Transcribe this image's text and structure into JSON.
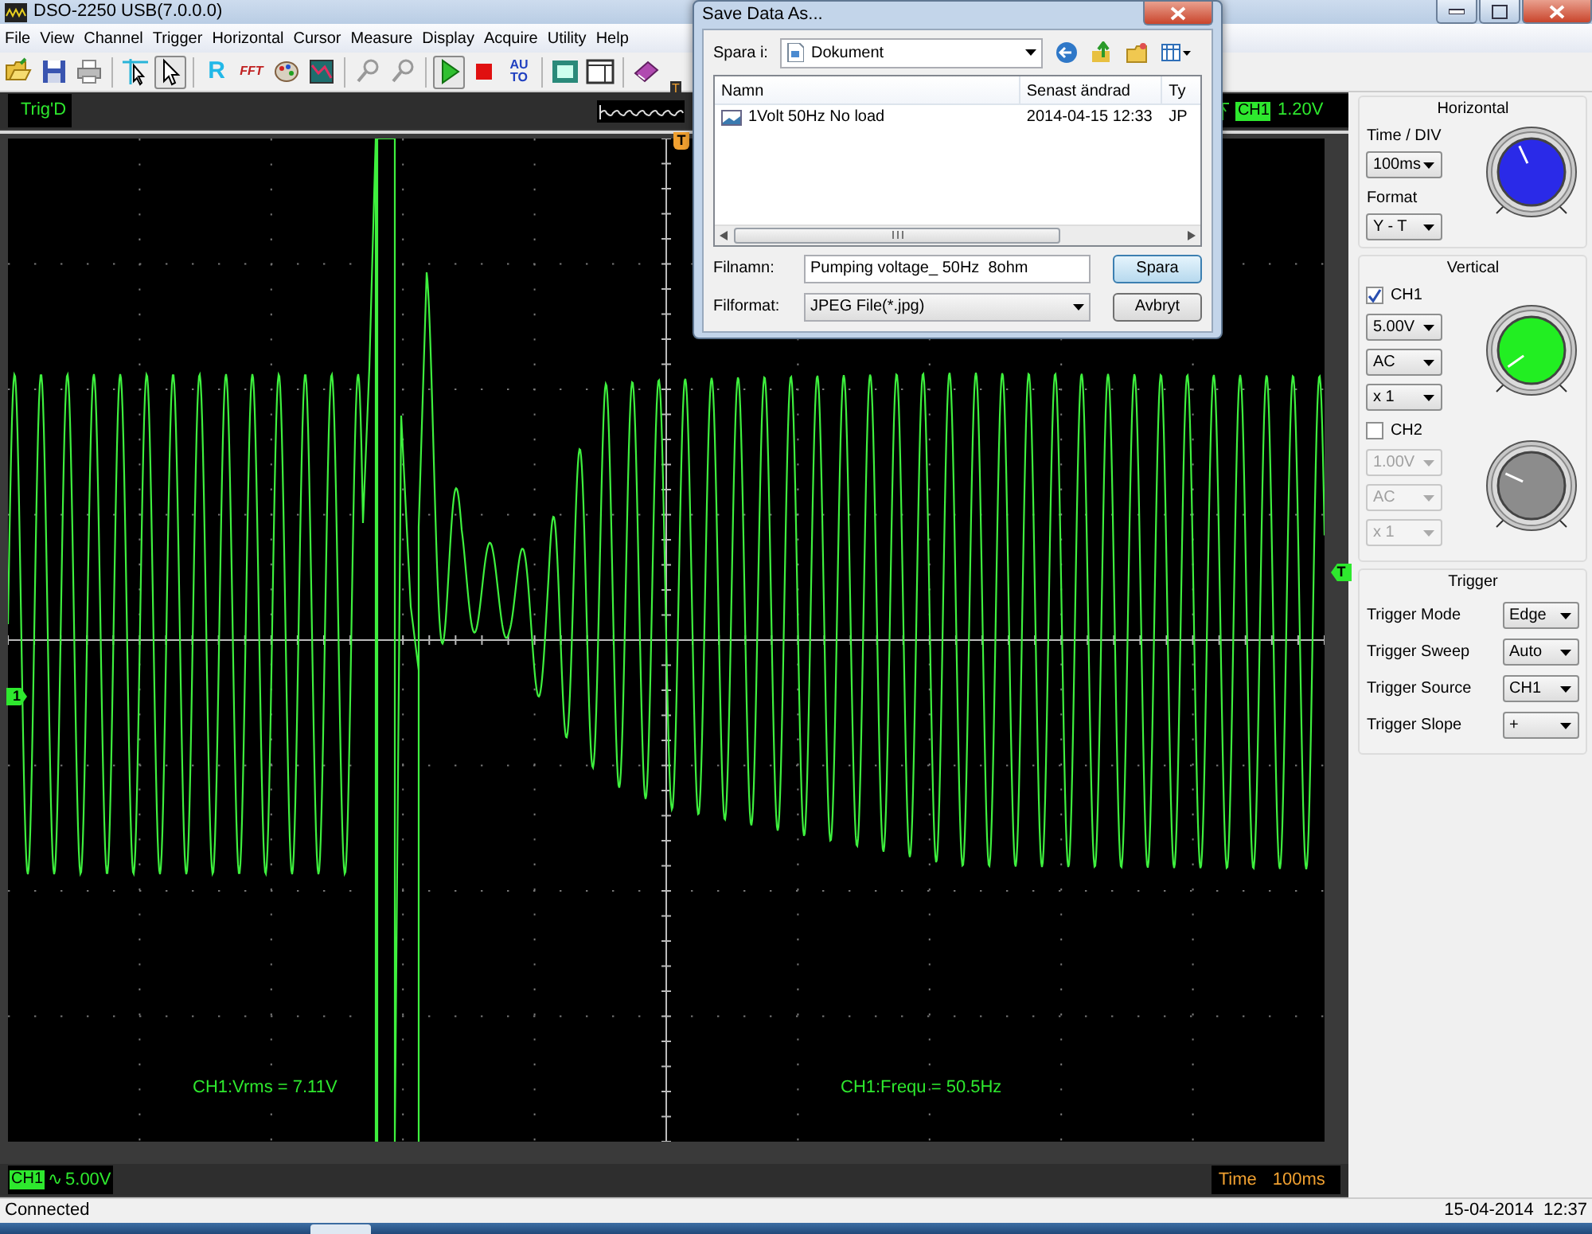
{
  "window": {
    "title": "DSO-2250 USB(7.0.0.0)"
  },
  "menu": [
    "File",
    "View",
    "Channel",
    "Trigger",
    "Horizontal",
    "Cursor",
    "Measure",
    "Display",
    "Acquire",
    "Utility",
    "Help"
  ],
  "toolbar": [
    {
      "kind": "open",
      "pressed": false
    },
    {
      "kind": "save",
      "pressed": false
    },
    {
      "kind": "print",
      "pressed": false
    },
    {
      "kind": "separator"
    },
    {
      "kind": "cursor",
      "pressed": false
    },
    {
      "kind": "pointer",
      "pressed": true
    },
    {
      "kind": "separator"
    },
    {
      "kind": "text",
      "label": "R",
      "pressed": false
    },
    {
      "kind": "fft",
      "label": "FFT",
      "pressed": false
    },
    {
      "kind": "palette",
      "pressed": false
    },
    {
      "kind": "chart",
      "pressed": false
    },
    {
      "kind": "separator"
    },
    {
      "kind": "zoom",
      "pressed": false
    },
    {
      "kind": "zoom",
      "pressed": false
    },
    {
      "kind": "separator"
    },
    {
      "kind": "run",
      "pressed": true
    },
    {
      "kind": "stop",
      "pressed": false
    },
    {
      "kind": "auto",
      "label": "AUTO",
      "pressed": false
    },
    {
      "kind": "separator"
    },
    {
      "kind": "fullscreen",
      "pressed": false
    },
    {
      "kind": "panel",
      "pressed": false
    },
    {
      "kind": "separator"
    },
    {
      "kind": "book",
      "pressed": false
    }
  ],
  "scope": {
    "acquisition_status": "Trig'D",
    "overview_marker": "T",
    "trigger_channel": "CH1",
    "trigger_level": "1.20V",
    "time_marker": "T",
    "ch1_marker": "1",
    "trigger_level_marker": "T",
    "measurements": [
      "CH1:Vrms = 7.11V",
      "CH1:Frequ = 50.5Hz"
    ],
    "channel_badge": "CH1",
    "coupling_symbol": "∿",
    "volts_per_div": "5.00V",
    "time_label": "Time",
    "time_per_div": "100ms"
  },
  "horizontal": {
    "title": "Horizontal",
    "time_div_label": "Time / DIV",
    "time_div": "100ms",
    "format_label": "Format",
    "format": "Y - T"
  },
  "vertical": {
    "title": "Vertical",
    "channels": [
      {
        "label": "CH1",
        "checked": true,
        "volts": "5.00V",
        "coupling": "AC",
        "probe": "x 1"
      },
      {
        "label": "CH2",
        "checked": false,
        "volts": "1.00V",
        "coupling": "AC",
        "probe": "x 1"
      }
    ]
  },
  "trigger": {
    "title": "Trigger",
    "rows": [
      {
        "label": "Trigger Mode",
        "value": "Edge"
      },
      {
        "label": "Trigger Sweep",
        "value": "Auto"
      },
      {
        "label": "Trigger Source",
        "value": "CH1"
      },
      {
        "label": "Trigger Slope",
        "value": "+"
      }
    ]
  },
  "status_bar": {
    "text": "Connected",
    "datetime": "15-04-2014  12:37"
  },
  "dialog": {
    "title": "Save Data As...",
    "save_in_label": "Spara i:",
    "save_in": "Dokument",
    "columns": [
      "Namn",
      "Senast ändrad",
      "Ty"
    ],
    "files": [
      {
        "name": "1Volt 50Hz No load",
        "modified": "2014-04-15 12:33",
        "type": "JP"
      }
    ],
    "filename_label": "Filnamn:",
    "filename": "Pumping voltage_ 50Hz  8ohm",
    "format_label": "Filformat:",
    "format": "JPEG File(*.jpg)",
    "buttons": [
      {
        "label": "Spara",
        "default": true
      },
      {
        "label": "Avbryt",
        "default": false
      }
    ]
  }
}
